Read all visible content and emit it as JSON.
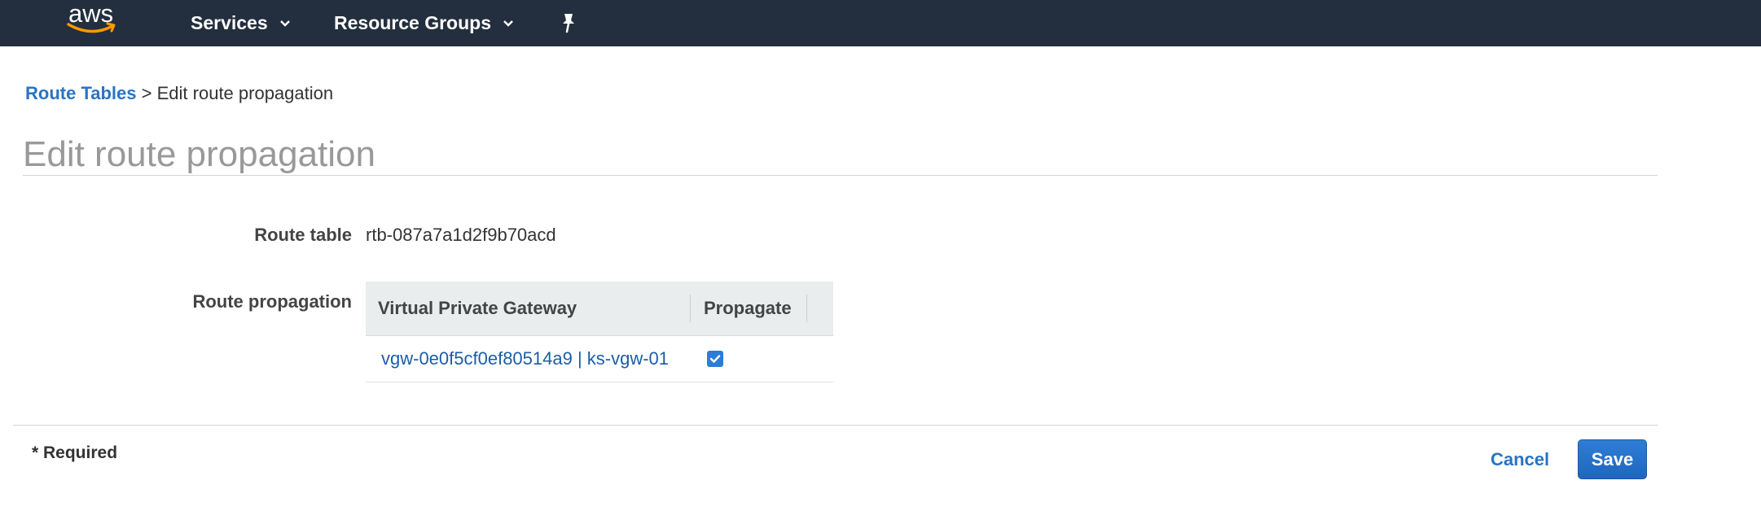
{
  "nav": {
    "logo_text": "aws",
    "services_label": "Services",
    "resource_groups_label": "Resource Groups"
  },
  "breadcrumb": {
    "parent": "Route Tables",
    "separator": ">",
    "current": "Edit route propagation"
  },
  "page": {
    "title": "Edit route propagation"
  },
  "form": {
    "route_table_label": "Route table",
    "route_table_value": "rtb-087a7a1d2f9b70acd",
    "route_propagation_label": "Route propagation",
    "table": {
      "headers": [
        "Virtual Private Gateway",
        "Propagate"
      ],
      "rows": [
        {
          "gateway": "vgw-0e0f5cf0ef80514a9 | ks-vgw-01",
          "propagate": true
        }
      ]
    }
  },
  "footer": {
    "required_note": "* Required",
    "cancel_label": "Cancel",
    "save_label": "Save"
  },
  "colors": {
    "nav_bg": "#232f3e",
    "link": "#2a73c4",
    "primary_button": "#1f66bf",
    "checkbox": "#2b7dd9",
    "logo_smile": "#ff9900"
  }
}
